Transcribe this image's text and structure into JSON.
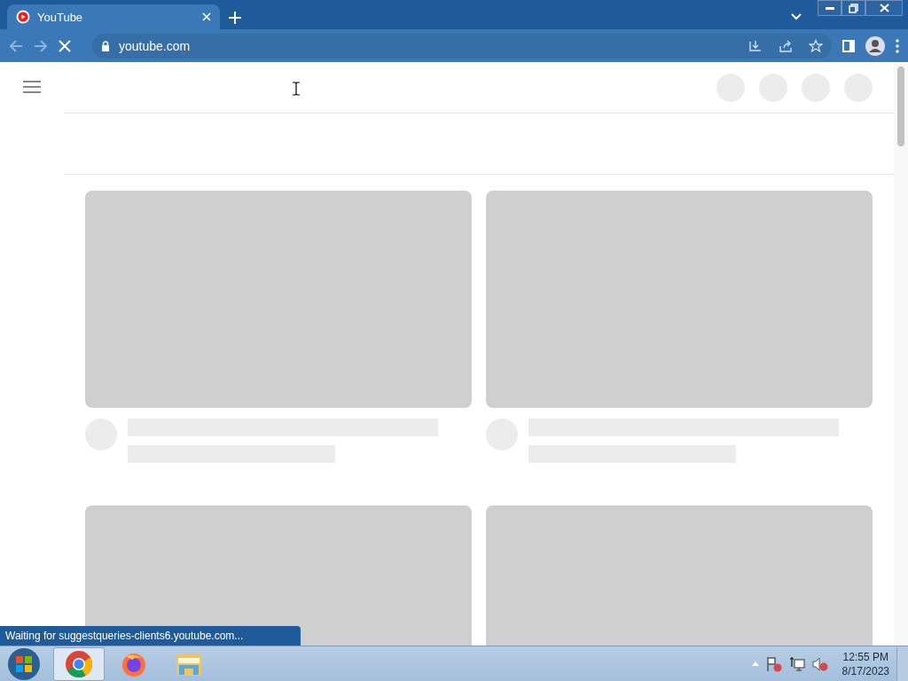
{
  "browser": {
    "tabs": [
      {
        "title": "YouTube",
        "selected": true
      }
    ],
    "address": "youtube.com",
    "loading": true
  },
  "page": {
    "cards": [
      {
        "kind": "video"
      },
      {
        "kind": "video"
      },
      {
        "kind": "thumbnail_only"
      },
      {
        "kind": "thumbnail_only"
      }
    ]
  },
  "status_bubble": "Waiting for suggestqueries-clients6.youtube.com...",
  "taskbar": {
    "apps": [
      {
        "kind": "chrome",
        "selected": true
      },
      {
        "kind": "firefox",
        "selected": false
      },
      {
        "kind": "explorer",
        "selected": false
      }
    ],
    "time": "12:55 PM",
    "date": "8/17/2023"
  }
}
